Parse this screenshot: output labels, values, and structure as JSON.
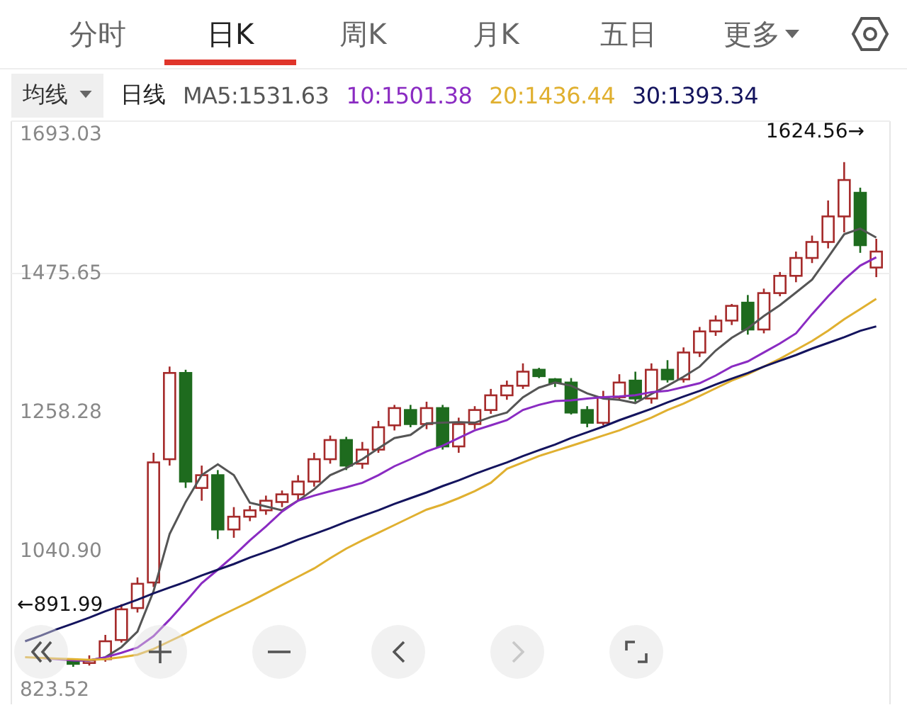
{
  "tabs": [
    {
      "label": "分时",
      "selected": false
    },
    {
      "label": "日K",
      "selected": true
    },
    {
      "label": "周K",
      "selected": false
    },
    {
      "label": "月K",
      "selected": false
    },
    {
      "label": "五日",
      "selected": false
    }
  ],
  "more_menu": {
    "label": "更多"
  },
  "indicator_dropdown": {
    "label": "均线"
  },
  "period_label": "日线",
  "moving_averages": [
    {
      "label": "MA5:1531.63",
      "color": "#555555"
    },
    {
      "label": "10:1501.38",
      "color": "#8a2bc2"
    },
    {
      "label": "20:1436.44",
      "color": "#e0b030"
    },
    {
      "label": "30:1393.34",
      "color": "#14145e"
    }
  ],
  "chart": {
    "high_marker": "1624.56→",
    "low_marker": "←891.99",
    "chart_data": {
      "type": "candlestick",
      "categories": [
        null,
        null,
        null,
        null,
        null,
        null,
        null,
        null,
        null,
        null,
        null,
        null,
        null,
        null,
        null,
        null,
        null,
        null,
        null,
        null,
        null,
        null,
        null,
        null,
        null,
        null,
        null,
        null,
        null,
        null,
        null,
        null,
        null,
        null,
        null,
        null,
        null,
        null,
        null,
        null,
        null,
        null,
        null,
        null,
        null,
        null,
        null,
        null,
        null,
        null,
        null,
        null,
        null,
        null
      ],
      "ylim": [
        801.3,
        1714.1
      ],
      "yticks": [
        {
          "value": 1693.03,
          "label": "1693.03"
        },
        {
          "value": 1475.65,
          "label": "1475.65"
        },
        {
          "value": 1258.28,
          "label": "1258.28"
        },
        {
          "value": 1040.9,
          "label": "1040.90"
        },
        {
          "value": 823.52,
          "label": "823.52"
        }
      ],
      "ohlc": [
        null,
        null,
        null,
        [
          868,
          872,
          860,
          866
        ],
        [
          866,
          878,
          862,
          870
        ],
        [
          872,
          910,
          868,
          900
        ],
        [
          902,
          958,
          898,
          950
        ],
        [
          952,
          1000,
          945,
          990
        ],
        [
          992,
          1195,
          985,
          1180
        ],
        [
          1185,
          1330,
          1175,
          1320
        ],
        [
          1320,
          1325,
          1140,
          1150
        ],
        [
          1140,
          1175,
          1120,
          1160
        ],
        [
          1160,
          1168,
          1060,
          1075
        ],
        [
          1075,
          1110,
          1062,
          1095
        ],
        [
          1095,
          1112,
          1088,
          1105
        ],
        [
          1105,
          1128,
          1098,
          1120
        ],
        [
          1118,
          1136,
          1110,
          1130
        ],
        [
          1130,
          1160,
          1120,
          1150
        ],
        [
          1150,
          1195,
          1142,
          1185
        ],
        [
          1185,
          1222,
          1178,
          1215
        ],
        [
          1215,
          1220,
          1168,
          1175
        ],
        [
          1178,
          1212,
          1170,
          1200
        ],
        [
          1200,
          1245,
          1195,
          1235
        ],
        [
          1238,
          1270,
          1230,
          1265
        ],
        [
          1262,
          1270,
          1235,
          1240
        ],
        [
          1240,
          1275,
          1232,
          1265
        ],
        [
          1265,
          1270,
          1200,
          1205
        ],
        [
          1205,
          1250,
          1195,
          1240
        ],
        [
          1240,
          1268,
          1232,
          1262
        ],
        [
          1262,
          1295,
          1256,
          1285
        ],
        [
          1285,
          1308,
          1278,
          1300
        ],
        [
          1300,
          1335,
          1295,
          1322
        ],
        [
          1325,
          1328,
          1312,
          1315
        ],
        [
          1310,
          1312,
          1298,
          1305
        ],
        [
          1305,
          1312,
          1255,
          1258
        ],
        [
          1262,
          1268,
          1235,
          1242
        ],
        [
          1242,
          1292,
          1238,
          1282
        ],
        [
          1282,
          1318,
          1278,
          1305
        ],
        [
          1308,
          1322,
          1275,
          1280
        ],
        [
          1280,
          1335,
          1272,
          1325
        ],
        [
          1325,
          1340,
          1305,
          1310
        ],
        [
          1310,
          1360,
          1305,
          1352
        ],
        [
          1352,
          1392,
          1345,
          1385
        ],
        [
          1385,
          1410,
          1378,
          1402
        ],
        [
          1402,
          1428,
          1395,
          1425
        ],
        [
          1430,
          1442,
          1380,
          1388
        ],
        [
          1388,
          1452,
          1382,
          1445
        ],
        [
          1445,
          1478,
          1440,
          1472
        ],
        [
          1472,
          1510,
          1462,
          1500
        ],
        [
          1500,
          1535,
          1492,
          1525
        ],
        [
          1525,
          1590,
          1515,
          1565
        ],
        [
          1565,
          1650,
          1540,
          1622
        ],
        [
          1602,
          1610,
          1508,
          1520
        ],
        [
          1485,
          1530,
          1470,
          1510
        ]
      ],
      "series": [
        {
          "type": "line",
          "color": "#555555",
          "values": [
            null,
            null,
            null,
            870,
            870,
            875,
            891,
            915,
            978,
            1068,
            1118,
            1160,
            1177,
            1160,
            1117,
            1111,
            1105,
            1120,
            1138,
            1160,
            1171,
            1185,
            1202,
            1218,
            1223,
            1241,
            1242,
            1243,
            1242,
            1251,
            1258,
            1282,
            1297,
            1305,
            1300,
            1288,
            1280,
            1278,
            1273,
            1287,
            1300,
            1314,
            1330,
            1355,
            1375,
            1390,
            1409,
            1426,
            1446,
            1466,
            1501,
            1537,
            1546,
            1532
          ]
        },
        {
          "type": "line",
          "color": "#8a2bc2",
          "values": [
            null,
            874,
            872,
            870,
            870,
            875,
            882,
            890,
            908,
            934,
            962,
            991,
            1012,
            1034,
            1058,
            1080,
            1103,
            1120,
            1128,
            1135,
            1141,
            1148,
            1160,
            1174,
            1185,
            1197,
            1206,
            1218,
            1230,
            1238,
            1246,
            1262,
            1270,
            1276,
            1277,
            1280,
            1282,
            1283,
            1285,
            1290,
            1292,
            1298,
            1304,
            1316,
            1330,
            1338,
            1352,
            1366,
            1382,
            1412,
            1440,
            1466,
            1488,
            1501
          ]
        },
        {
          "type": "line",
          "color": "#e0b030",
          "values": [
            875,
            874,
            873,
            872,
            871,
            872,
            875,
            879,
            888,
            900,
            912,
            925,
            938,
            950,
            962,
            975,
            988,
            1001,
            1014,
            1030,
            1045,
            1058,
            1070,
            1082,
            1094,
            1106,
            1114,
            1124,
            1135,
            1148,
            1170,
            1180,
            1190,
            1198,
            1206,
            1214,
            1222,
            1230,
            1240,
            1250,
            1262,
            1272,
            1284,
            1296,
            1308,
            1318,
            1330,
            1342,
            1356,
            1370,
            1386,
            1404,
            1420,
            1436
          ]
        },
        {
          "type": "line",
          "color": "#14145e",
          "values": [
            900,
            909,
            919,
            928,
            937,
            947,
            956,
            965,
            975,
            984,
            993,
            1003,
            1012,
            1021,
            1031,
            1040,
            1049,
            1059,
            1068,
            1077,
            1087,
            1096,
            1105,
            1115,
            1124,
            1133,
            1143,
            1152,
            1162,
            1171,
            1180,
            1190,
            1199,
            1208,
            1218,
            1227,
            1236,
            1246,
            1255,
            1264,
            1274,
            1283,
            1292,
            1302,
            1311,
            1320,
            1330,
            1339,
            1348,
            1358,
            1367,
            1376,
            1386,
            1393
          ]
        }
      ]
    }
  },
  "controls": [
    {
      "kind": "first",
      "disabled": false
    },
    {
      "kind": "zoom-in",
      "disabled": false
    },
    {
      "kind": "zoom-out",
      "disabled": false
    },
    {
      "kind": "previous",
      "disabled": false
    },
    {
      "kind": "next",
      "disabled": true
    },
    {
      "kind": "fullscreen",
      "disabled": false
    }
  ]
}
